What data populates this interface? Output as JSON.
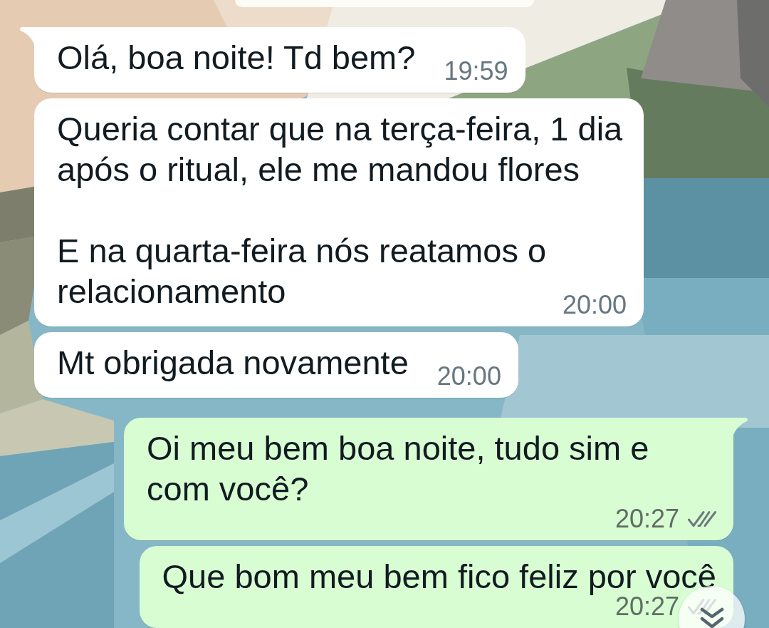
{
  "messages": [
    {
      "kind": "incoming",
      "tail": true,
      "paragraphs": [
        "Olá, boa noite! Td bem?"
      ],
      "time": "19:59"
    },
    {
      "kind": "incoming",
      "tail": false,
      "paragraphs": [
        "Queria contar que na terça-feira, 1 dia após o ritual, ele me mandou flores",
        "E na quarta-feira nós reatamos o relacionamento"
      ],
      "time": "20:00"
    },
    {
      "kind": "incoming",
      "tail": false,
      "paragraphs": [
        "Mt obrigada novamente"
      ],
      "time": "20:00"
    },
    {
      "kind": "outgoing",
      "tail": true,
      "paragraphs": [
        "Oi meu bem boa noite, tudo sim e com você?"
      ],
      "time": "20:27",
      "read": false
    },
    {
      "kind": "outgoing",
      "tail": false,
      "paragraphs": [
        "Que bom meu bem fico feliz por você"
      ],
      "time": "20:27",
      "read": false
    }
  ]
}
